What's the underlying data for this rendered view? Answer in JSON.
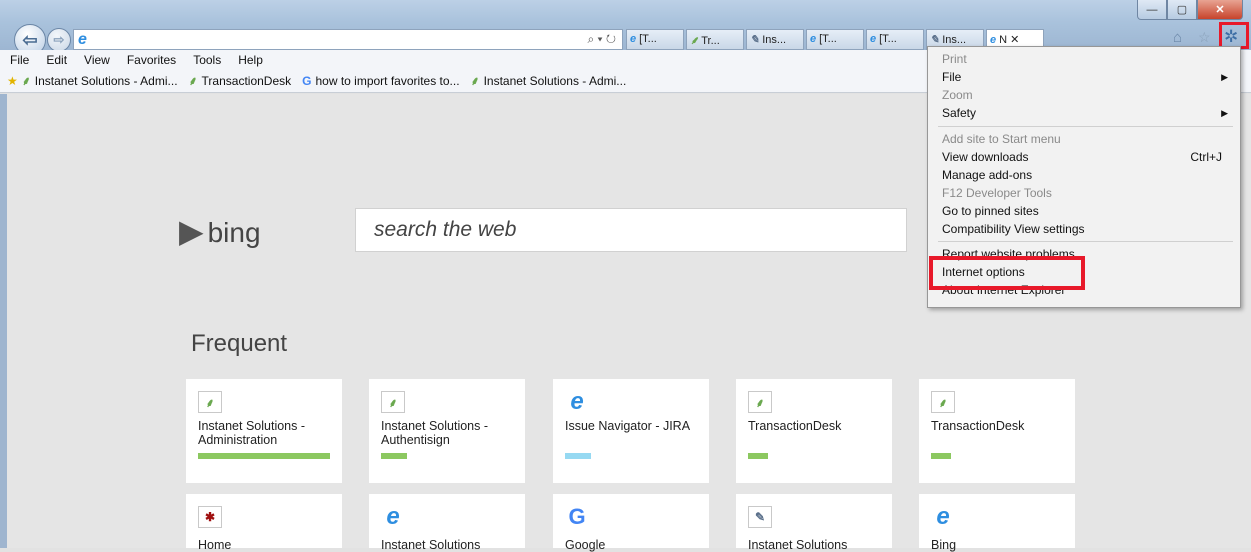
{
  "window": {
    "min": "—",
    "max": "▢",
    "close": "✕"
  },
  "nav": {
    "back": "⇦",
    "forward": "⇨"
  },
  "address": {
    "icon": "e",
    "tools": "⌕ ▾ ↻"
  },
  "tabs": [
    {
      "icon": "e",
      "label": "[T..."
    },
    {
      "icon": "⸙",
      "label": "Tr..."
    },
    {
      "icon": "✎",
      "label": "Ins..."
    },
    {
      "icon": "e",
      "label": "[T..."
    },
    {
      "icon": "e",
      "label": "[T..."
    },
    {
      "icon": "✎",
      "label": "Ins..."
    },
    {
      "icon": "e",
      "label": "N ✕"
    }
  ],
  "toolbar_icons": {
    "home": "⌂",
    "favorites": "☆",
    "tools": "✲"
  },
  "menubar": [
    "File",
    "Edit",
    "View",
    "Favorites",
    "Tools",
    "Help"
  ],
  "favorites": [
    {
      "icon": "⸙",
      "label": "Instanet Solutions - Admi..."
    },
    {
      "icon": "⸙",
      "label": "TransactionDesk"
    },
    {
      "icon": "G",
      "label": "how to import favorites to..."
    },
    {
      "icon": "⸙",
      "label": "Instanet Solutions - Admi..."
    }
  ],
  "bing": {
    "logo_glyph": "▶",
    "text": "bing",
    "search_placeholder": "search the web"
  },
  "frequent": {
    "title": "Frequent",
    "row1": [
      {
        "icon": "⸙",
        "label": "Instanet Solutions - Administration",
        "bar_color": "#8cc860"
      },
      {
        "icon": "⸙",
        "label": "Instanet Solutions - Authentisign",
        "bar_color": "#8cc860"
      },
      {
        "icon": "e",
        "label": "Issue Navigator - JIRA",
        "bar_color": "#96d9f2"
      },
      {
        "icon": "⸙",
        "label": "TransactionDesk",
        "bar_color": "#8cc860"
      },
      {
        "icon": "⸙",
        "label": "TransactionDesk",
        "bar_color": "#8cc860"
      }
    ],
    "row2": [
      {
        "icon": "✱",
        "label": "Home"
      },
      {
        "icon": "e",
        "label": "Instanet Solutions"
      },
      {
        "icon": "G",
        "label": "Google"
      },
      {
        "icon": "✎",
        "label": "Instanet Solutions"
      },
      {
        "icon": "e",
        "label": "Bing"
      }
    ]
  },
  "tools_menu": {
    "items": [
      {
        "label": "Print",
        "disabled": true
      },
      {
        "label": "File",
        "submenu": true
      },
      {
        "label": "Zoom",
        "disabled": true
      },
      {
        "label": "Safety",
        "submenu": true
      },
      {
        "label": "Add site to Start menu",
        "disabled": true
      },
      {
        "label": "View downloads",
        "shortcut": "Ctrl+J"
      },
      {
        "label": "Manage add-ons"
      },
      {
        "label": "F12 Developer Tools",
        "disabled": true
      },
      {
        "label": "Go to pinned sites"
      },
      {
        "label": "Compatibility View settings"
      },
      {
        "label": "Report website problems"
      },
      {
        "label": "Internet options"
      },
      {
        "label": "About Internet Explorer"
      }
    ],
    "submenu_arrow": "▶"
  },
  "colors": {
    "highlight": "#e8192a",
    "accent": "#2e8ee0"
  }
}
